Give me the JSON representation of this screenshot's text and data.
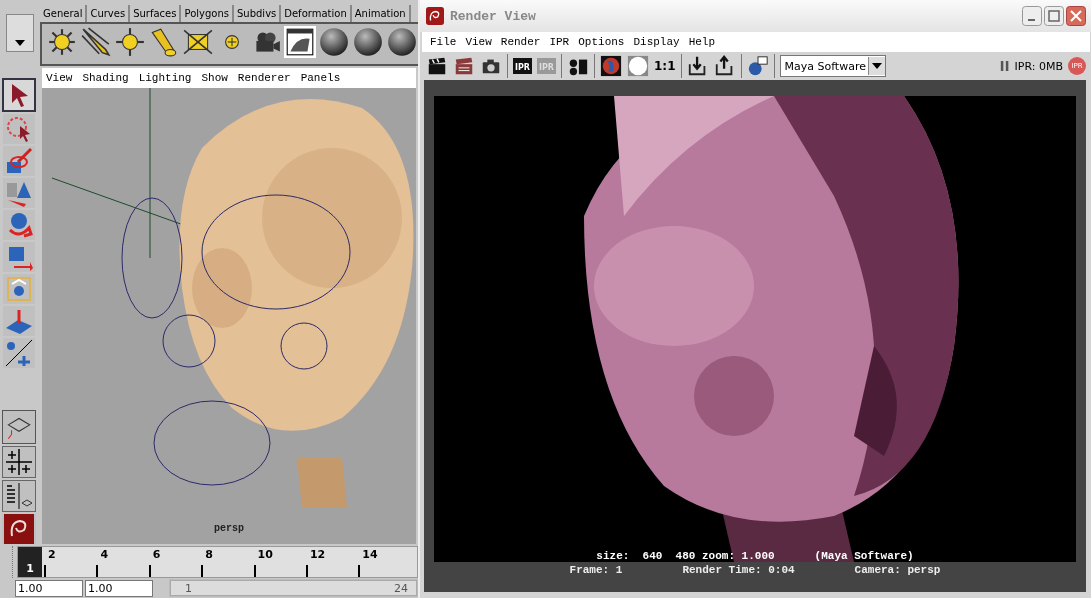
{
  "shelf": {
    "tabs": [
      {
        "label": "General"
      },
      {
        "label": "Curves"
      },
      {
        "label": "Surfaces"
      },
      {
        "label": "Polygons"
      },
      {
        "label": "Subdivs"
      },
      {
        "label": "Deformation"
      },
      {
        "label": "Animation"
      }
    ]
  },
  "viewport": {
    "menu": [
      "View",
      "Shading",
      "Lighting",
      "Show",
      "Renderer",
      "Panels"
    ],
    "camera_label": "persp",
    "kind": "picture"
  },
  "time_slider": {
    "level": 0,
    "current": "1",
    "ticks": [
      "2",
      "4",
      "6",
      "8",
      "10",
      "12",
      "14"
    ]
  },
  "range": {
    "level": 1,
    "start_field": "1.00",
    "current_field": "1.00",
    "range_start": "1",
    "range_end": "24"
  },
  "render_view": {
    "title": "Render View",
    "menu": [
      "File",
      "View",
      "Render",
      "IPR",
      "Options",
      "Display",
      "Help"
    ],
    "toolbar": {
      "ipr_badges": [
        "IPR",
        "IPR"
      ],
      "ratio": "1:1",
      "renderer": "Maya Software",
      "ipr_memory": "IPR: 0MB",
      "ipr_button": "IPR"
    },
    "image": {
      "kind": "picture",
      "info": "size:  640  480 zoom: 1.000",
      "renderer_note": "(Maya Software)"
    },
    "status": {
      "frame": "Frame: 1",
      "render_time": "Render Time: 0:04",
      "camera": "Camera: persp"
    }
  }
}
